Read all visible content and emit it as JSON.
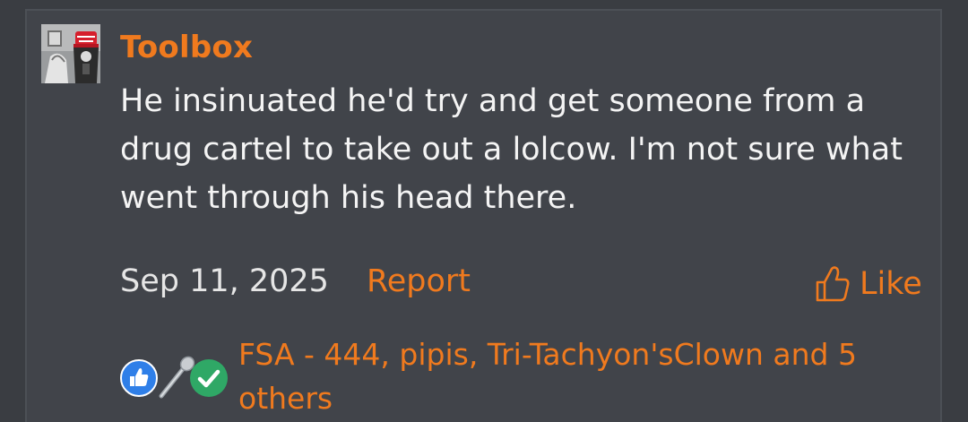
{
  "post": {
    "author": "Toolbox",
    "message": "He insinuated he'd try and get someone from a drug cartel to take out a lolcow. I'm not sure what went through his head there.",
    "date": "Sep 11, 2025",
    "report_label": "Report",
    "like_label": "Like"
  },
  "reactions": {
    "icons": [
      "thumbs-up-icon",
      "spoon-icon",
      "checkmark-icon"
    ],
    "summary": "FSA - 444, pipis, Tri-Tachyon'sClown and 5 others"
  },
  "colors": {
    "accent": "#f07a1e",
    "background": "#3a3d42",
    "post_background": "#41444a",
    "text": "#f4f4f4",
    "like_reaction": "#2f7fe8",
    "check_reaction": "#2fa866"
  }
}
